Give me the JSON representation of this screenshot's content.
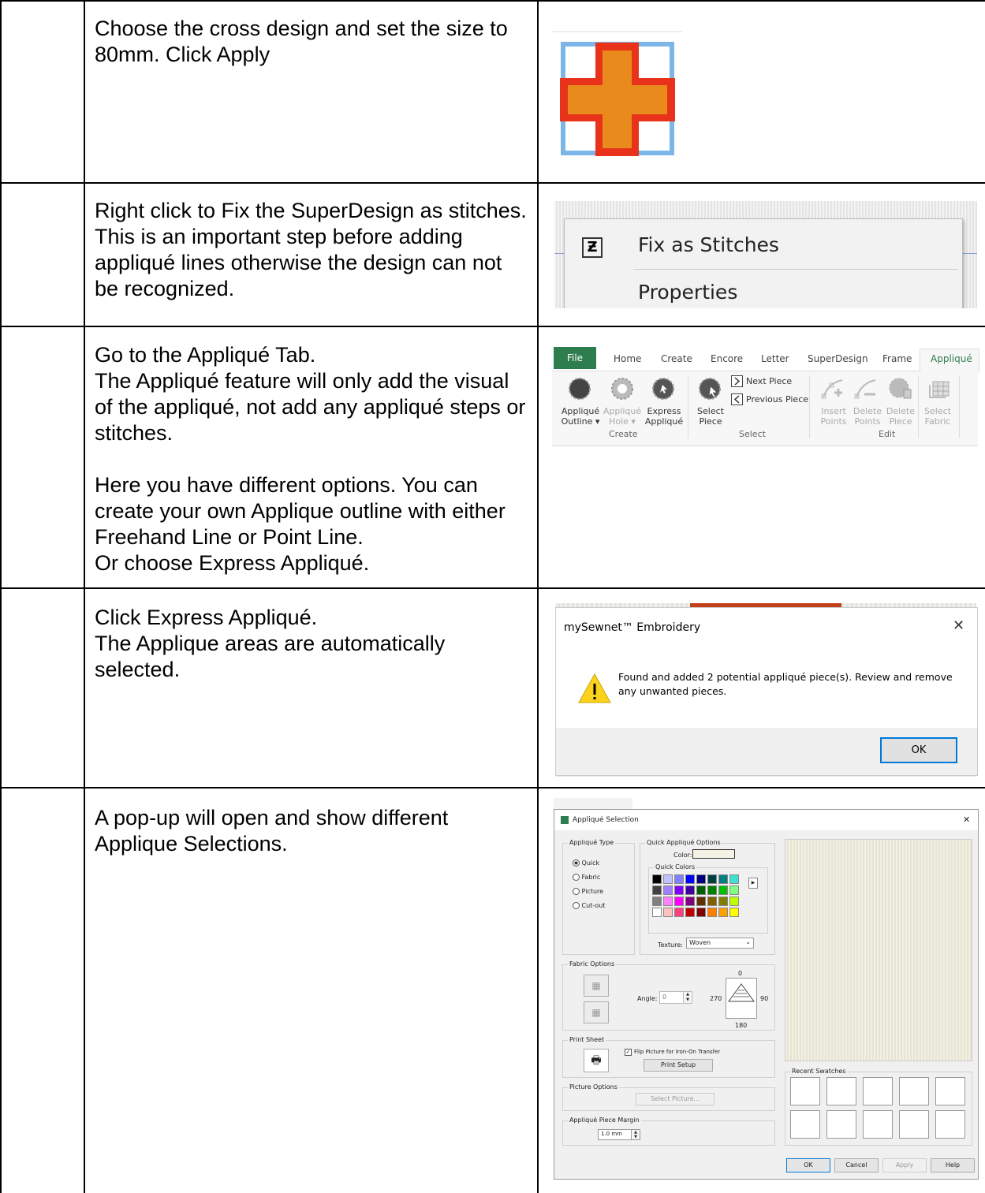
{
  "steps": [
    {
      "text": "Choose the cross design and set the size to 80mm. Click Apply"
    },
    {
      "text": "Right click to Fix the SuperDesign as stitches. This is an important step before adding appliqué lines otherwise the design can not be recognized."
    },
    {
      "text": "Go to the Appliqué Tab.\nThe Appliqué feature will only add the visual of the appliqué, not add any appliqué steps or stitches.\n\nHere you have different options. You can create your own Applique outline with either Freehand Line or Point Line.\nOr choose Express Appliqué."
    },
    {
      "text": "Click Express Appliqué.\nThe Applique areas are automatically selected."
    },
    {
      "text": "A pop-up will open and show different Applique Selections."
    }
  ],
  "context_menu": {
    "item1": "Fix as Stitches",
    "item2": "Properties"
  },
  "ribbon": {
    "tabs": [
      "File",
      "Home",
      "Create",
      "Encore",
      "Letter",
      "SuperDesign",
      "Frame",
      "Appliqué"
    ],
    "buttons": {
      "applique_outline": "Appliqué\nOutline ▾",
      "applique_hole": "Appliqué\nHole ▾",
      "express_applique": "Express\nAppliqué",
      "select_piece": "Select\nPiece",
      "next_piece": "Next Piece",
      "previous_piece": "Previous Piece",
      "insert_points": "Insert\nPoints",
      "delete_points": "Delete\nPoints",
      "delete_piece": "Delete\nPiece",
      "select_fabric": "Select\nFabric"
    },
    "groups": {
      "create": "Create",
      "select": "Select",
      "edit": "Edit"
    }
  },
  "message_box": {
    "title": "mySewnet™ Embroidery",
    "line1": "Found and added 2 potential appliqué piece(s). Review and remove",
    "line2": "any unwanted pieces.",
    "ok": "OK"
  },
  "dialog": {
    "title": "Appliqué Selection",
    "applique_type": {
      "label": "Appliqué Type",
      "options": [
        "Quick",
        "Fabric",
        "Picture",
        "Cut-out"
      ],
      "selected": "Quick"
    },
    "quick_options": {
      "label": "Quick Appliqué  Options",
      "color_label": "Color:",
      "quick_colors_label": "Quick Colors",
      "texture_label": "Texture:",
      "texture_value": "Woven"
    },
    "fabric_options": {
      "label": "Fabric Options",
      "angle_label": "Angle:",
      "angle_value": "0",
      "dial": {
        "top": "0",
        "right": "90",
        "bottom": "180",
        "left": "270"
      }
    },
    "print_sheet": {
      "label": "Print Sheet",
      "flip_label": "Flip Picture for Iron-On Transfer",
      "flip_checked": true,
      "print_setup": "Print Setup"
    },
    "picture_options": {
      "label": "Picture Options",
      "select_picture": "Select Picture..."
    },
    "margin": {
      "label": "Appliqué Piece Margin",
      "value": "1.0 mm"
    },
    "recent_swatches": "Recent Swatches",
    "buttons": {
      "ok": "OK",
      "cancel": "Cancel",
      "apply": "Apply",
      "help": "Help"
    },
    "swatch_colors": [
      "#000000",
      "#c0c0ff",
      "#8080ff",
      "#0000ff",
      "#000080",
      "#004040",
      "#008080",
      "#40e0d0",
      "#404040",
      "#a080ff",
      "#8000ff",
      "#4000a0",
      "#006000",
      "#008000",
      "#00c000",
      "#80ff80",
      "#808080",
      "#ff80ff",
      "#ff00ff",
      "#800080",
      "#603000",
      "#806000",
      "#808000",
      "#c0ff00",
      "#ffffff",
      "#ffc0c0",
      "#ff4080",
      "#c00000",
      "#800000",
      "#ff8000",
      "#ffa000",
      "#ffff00"
    ]
  }
}
